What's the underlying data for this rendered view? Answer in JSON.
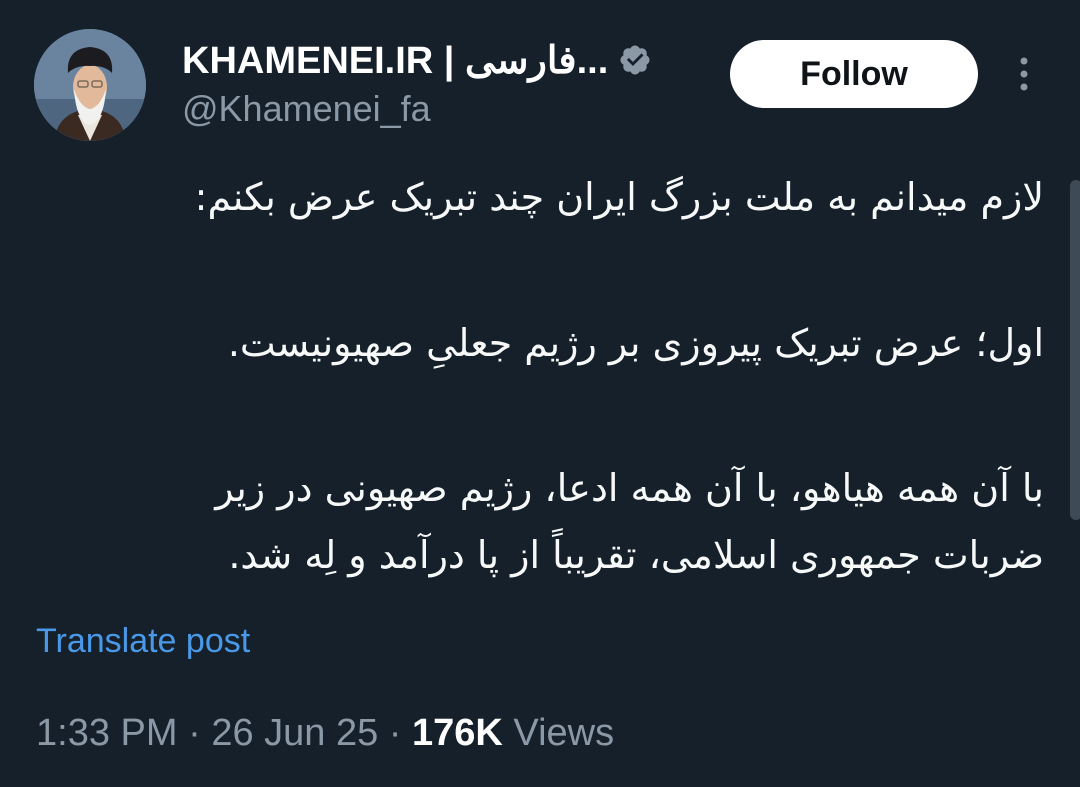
{
  "author": {
    "display_name": "KHAMENEI.IR | فارسی...",
    "handle": "@Khamenei_fa",
    "verified_icon": "verified-badge-icon",
    "verified_color": "#8b98a5"
  },
  "actions": {
    "follow_label": "Follow",
    "more_icon": "more-vertical-icon"
  },
  "tweet": {
    "paragraphs": [
      "لازم میدانم به ملت بزرگ ایران چند تبریک عرض بکنم:",
      "اول؛ عرض تبریک پیروزی بر رژیم جعلیِ صهیونیست.",
      "با آن همه هیاهو، با آن همه ادعا، رژیم صهیونی در زیر ضربات جمهوری اسلامی، تقریباً از پا درآمد و لِه شد."
    ],
    "translate_label": "Translate post"
  },
  "meta": {
    "time": "1:33 PM",
    "separator": "·",
    "date": "26 Jun 25",
    "views_count": "176K",
    "views_label": "Views"
  },
  "colors": {
    "background": "#15202b",
    "text": "#f7f9f9",
    "secondary": "#8b98a5",
    "link": "#4a99e9"
  }
}
